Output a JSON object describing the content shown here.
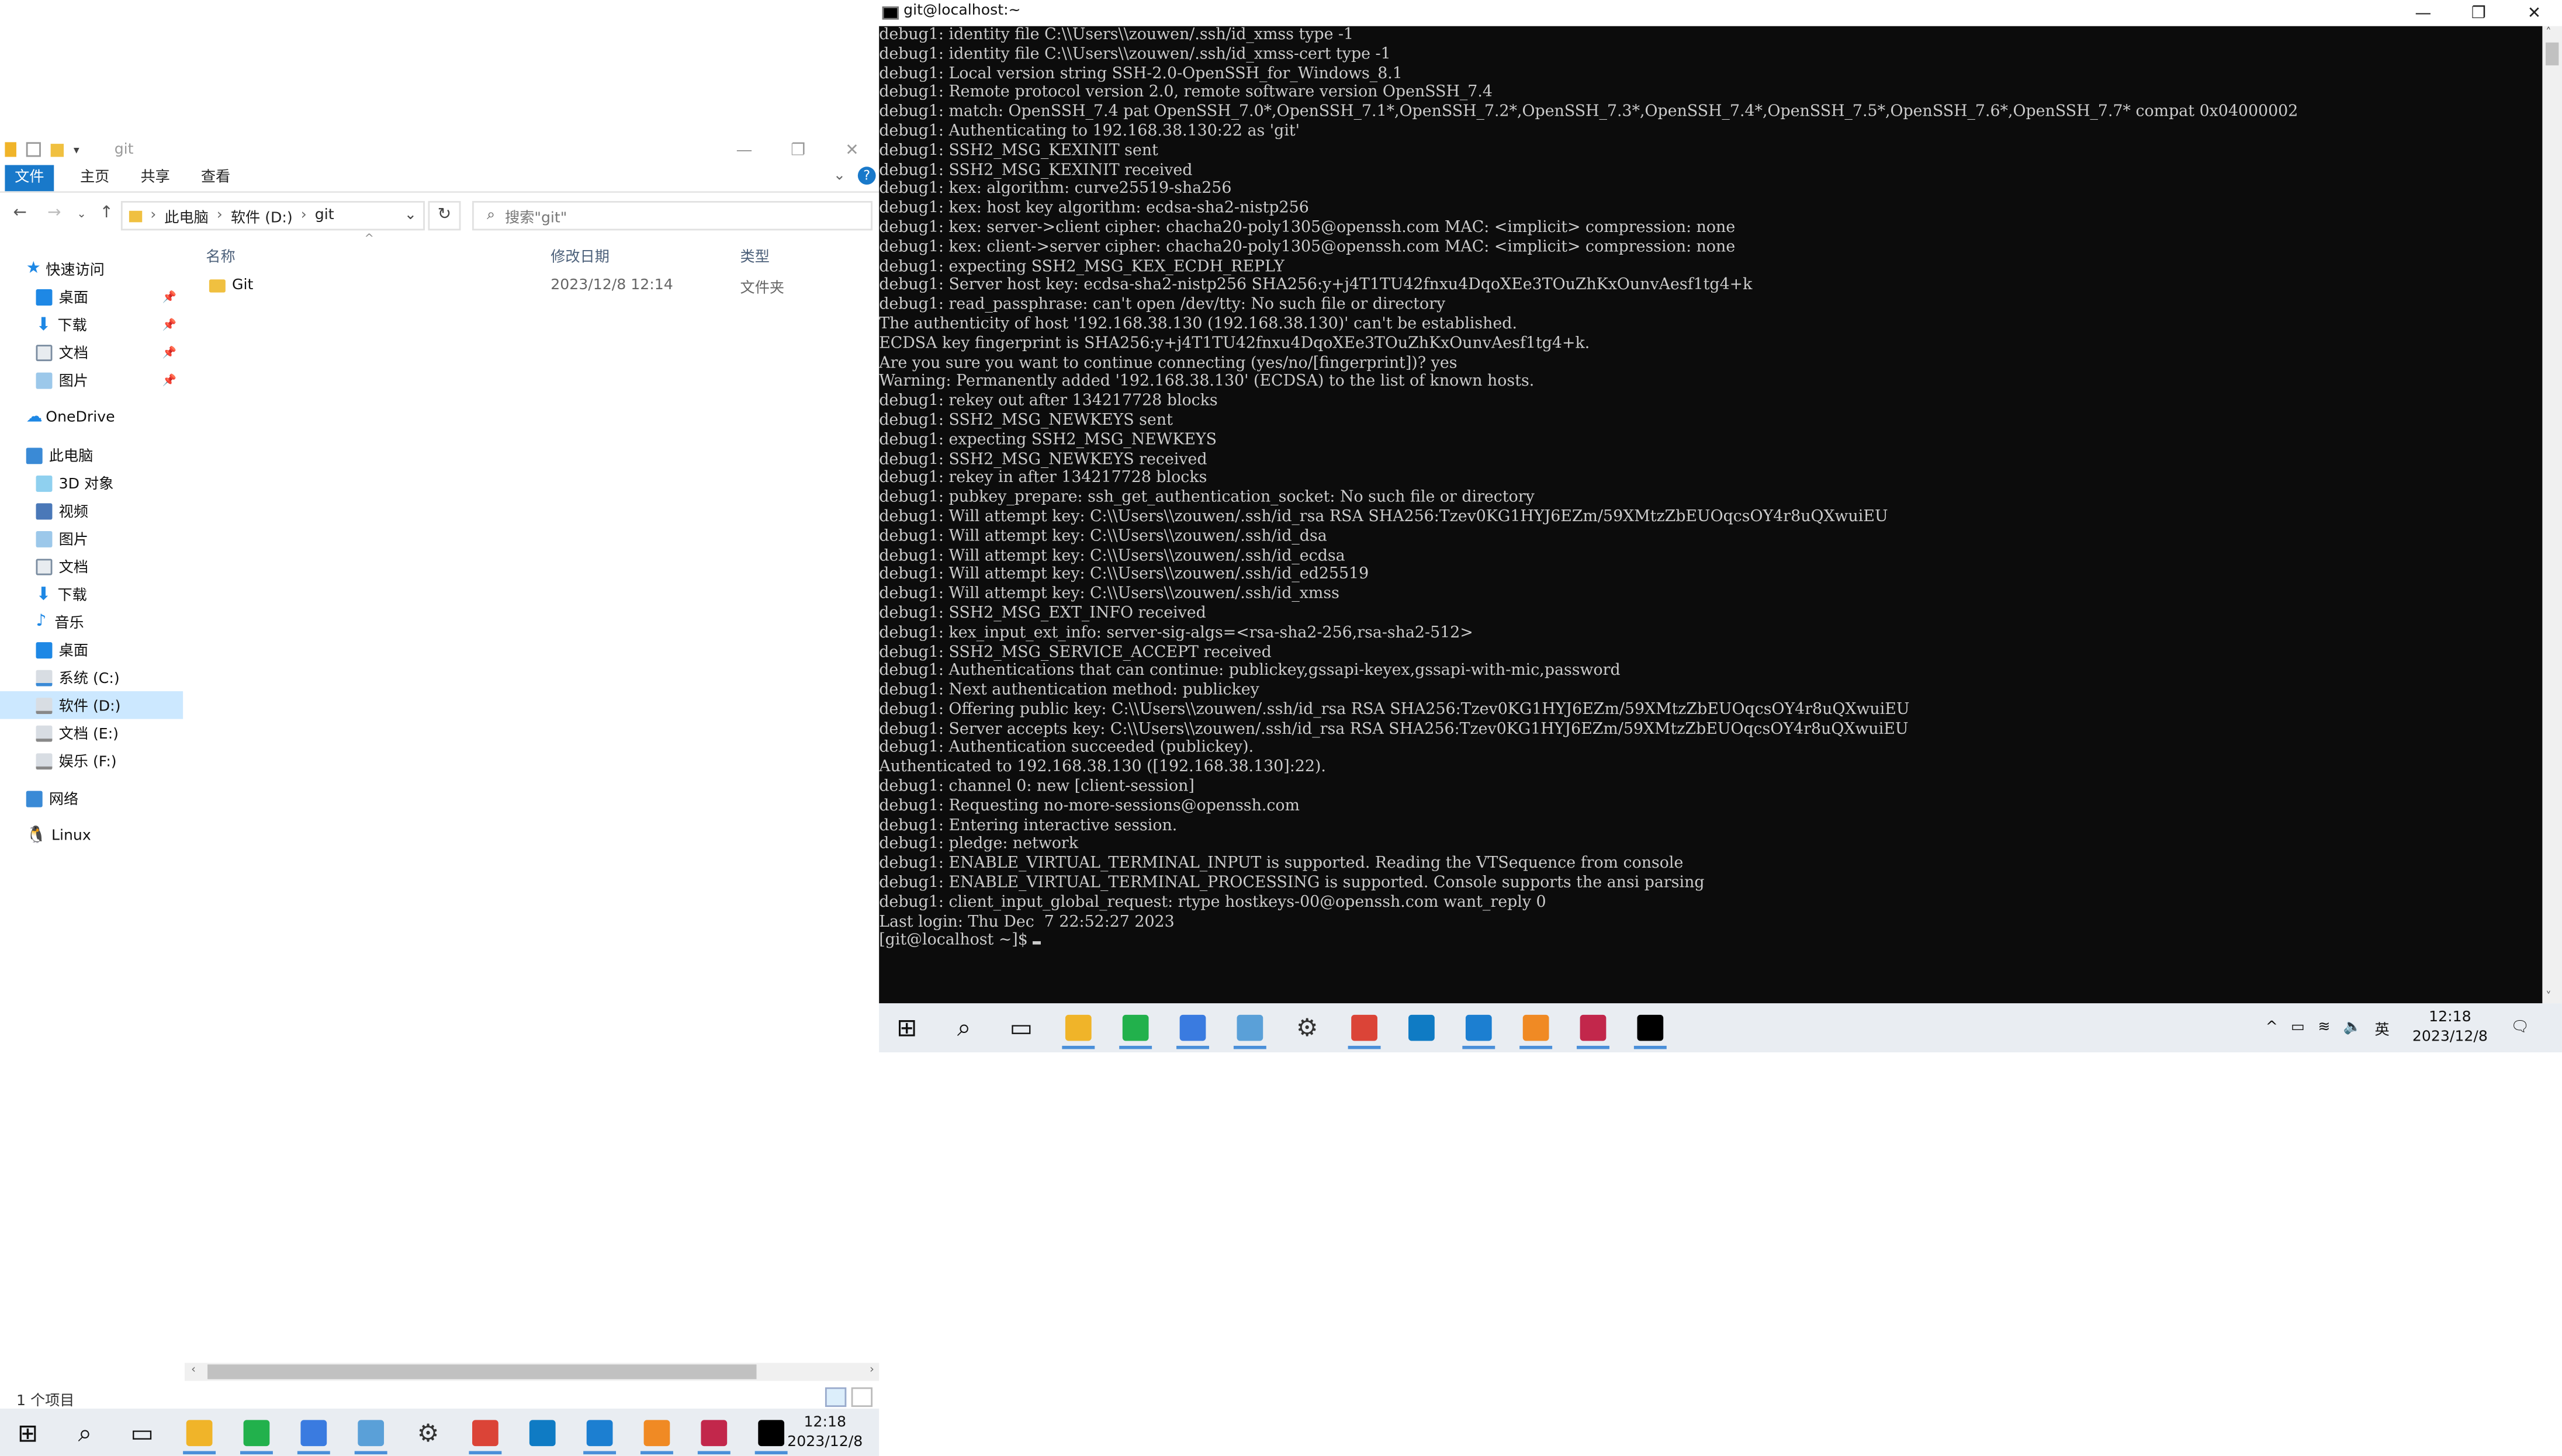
{
  "explorer": {
    "title": "git",
    "tabs": [
      "文件",
      "主页",
      "共享",
      "查看"
    ],
    "address": [
      "此电脑",
      "软件 (D:)",
      "git"
    ],
    "search_placeholder": "搜索\"git\"",
    "sidebar": [
      {
        "label": "快速访问",
        "icon": "star-icon",
        "color": "#1e88e5"
      },
      {
        "label": "桌面",
        "icon": "desktop-icon",
        "color": "#1e88e5",
        "pinned": true
      },
      {
        "label": "下载",
        "icon": "download-icon",
        "color": "#1e88e5",
        "pinned": true
      },
      {
        "label": "文档",
        "icon": "documents-icon",
        "color": "#7a8ca0",
        "pinned": true
      },
      {
        "label": "图片",
        "icon": "pictures-icon",
        "color": "#5aa0d8",
        "pinned": true
      },
      {
        "label": "OneDrive",
        "icon": "onedrive-icon",
        "color": "#1e88e5"
      },
      {
        "label": "此电脑",
        "icon": "computer-icon",
        "color": "#3a8ad6"
      },
      {
        "label": "3D 对象",
        "icon": "3d-objects-icon",
        "color": "#5ab0e0"
      },
      {
        "label": "视频",
        "icon": "video-icon",
        "color": "#4a78b8"
      },
      {
        "label": "图片",
        "icon": "pictures-icon",
        "color": "#5aa0d8"
      },
      {
        "label": "文档",
        "icon": "documents-icon",
        "color": "#7a8ca0"
      },
      {
        "label": "下载",
        "icon": "download-icon",
        "color": "#1e88e5"
      },
      {
        "label": "音乐",
        "icon": "music-icon",
        "color": "#1e88e5"
      },
      {
        "label": "桌面",
        "icon": "desktop-icon",
        "color": "#1e88e5"
      },
      {
        "label": "系统 (C:)",
        "icon": "drive-icon",
        "color": "#888"
      },
      {
        "label": "软件 (D:)",
        "icon": "drive-icon",
        "color": "#888",
        "selected": true
      },
      {
        "label": "文档 (E:)",
        "icon": "drive-icon",
        "color": "#888"
      },
      {
        "label": "娱乐 (F:)",
        "icon": "drive-icon",
        "color": "#888"
      },
      {
        "label": "网络",
        "icon": "network-icon",
        "color": "#3a8ad6"
      },
      {
        "label": "Linux",
        "icon": "linux-icon",
        "color": "#222"
      }
    ],
    "columns": {
      "name": "名称",
      "date": "修改日期",
      "type": "类型"
    },
    "files": [
      {
        "name": "Git",
        "date": "2023/12/8 12:14",
        "type": "文件夹"
      }
    ],
    "status": "1 个项目"
  },
  "taskbar": {
    "time": "12:18",
    "date": "2023/12/8",
    "ime": "英",
    "apps": [
      {
        "icon": "start-icon",
        "color": "#111",
        "glyph": "⊞"
      },
      {
        "icon": "search-icon",
        "color": "#111",
        "glyph": "⌕"
      },
      {
        "icon": "task-view-icon",
        "color": "#111",
        "glyph": "▭"
      },
      {
        "icon": "file-explorer-icon",
        "color": "#f0b429",
        "glyph": "",
        "running": true
      },
      {
        "icon": "wechat-icon",
        "color": "#22b14c",
        "glyph": "",
        "running": true
      },
      {
        "icon": "baidu-netdisk-icon",
        "color": "#3a7be0",
        "glyph": "",
        "running": true
      },
      {
        "icon": "remote-desktop-icon",
        "color": "#5aa0d8",
        "glyph": "",
        "running": true
      },
      {
        "icon": "settings-icon",
        "color": "#333",
        "glyph": "⚙"
      },
      {
        "icon": "chrome-icon",
        "color": "#db4437",
        "glyph": "",
        "running": true
      },
      {
        "icon": "edge-icon",
        "color": "#0f7bc4",
        "glyph": ""
      },
      {
        "icon": "vscode-icon",
        "color": "#1c7fd1",
        "glyph": "",
        "running": true
      },
      {
        "icon": "virtualbox-icon",
        "color": "#f08a24",
        "glyph": "",
        "running": true
      },
      {
        "icon": "snipping-icon",
        "color": "#c2274b",
        "glyph": "",
        "running": true
      },
      {
        "icon": "terminal-icon",
        "color": "#000",
        "glyph": "",
        "running": true
      }
    ]
  },
  "terminal": {
    "title": "git@localhost:~",
    "lines": [
      "debug1: identity file C:\\\\Users\\\\zouwen/.ssh/id_xmss type -1",
      "debug1: identity file C:\\\\Users\\\\zouwen/.ssh/id_xmss-cert type -1",
      "debug1: Local version string SSH-2.0-OpenSSH_for_Windows_8.1",
      "debug1: Remote protocol version 2.0, remote software version OpenSSH_7.4",
      "debug1: match: OpenSSH_7.4 pat OpenSSH_7.0*,OpenSSH_7.1*,OpenSSH_7.2*,OpenSSH_7.3*,OpenSSH_7.4*,OpenSSH_7.5*,OpenSSH_7.6*,OpenSSH_7.7* compat 0x04000002",
      "debug1: Authenticating to 192.168.38.130:22 as 'git'",
      "debug1: SSH2_MSG_KEXINIT sent",
      "debug1: SSH2_MSG_KEXINIT received",
      "debug1: kex: algorithm: curve25519-sha256",
      "debug1: kex: host key algorithm: ecdsa-sha2-nistp256",
      "debug1: kex: server->client cipher: chacha20-poly1305@openssh.com MAC: <implicit> compression: none",
      "debug1: kex: client->server cipher: chacha20-poly1305@openssh.com MAC: <implicit> compression: none",
      "debug1: expecting SSH2_MSG_KEX_ECDH_REPLY",
      "debug1: Server host key: ecdsa-sha2-nistp256 SHA256:y+j4T1TU42fnxu4DqoXEe3TOuZhKxOunvAesf1tg4+k",
      "debug1: read_passphrase: can't open /dev/tty: No such file or directory",
      "The authenticity of host '192.168.38.130 (192.168.38.130)' can't be established.",
      "ECDSA key fingerprint is SHA256:y+j4T1TU42fnxu4DqoXEe3TOuZhKxOunvAesf1tg4+k.",
      "Are you sure you want to continue connecting (yes/no/[fingerprint])? yes",
      "Warning: Permanently added '192.168.38.130' (ECDSA) to the list of known hosts.",
      "debug1: rekey out after 134217728 blocks",
      "debug1: SSH2_MSG_NEWKEYS sent",
      "debug1: expecting SSH2_MSG_NEWKEYS",
      "debug1: SSH2_MSG_NEWKEYS received",
      "debug1: rekey in after 134217728 blocks",
      "debug1: pubkey_prepare: ssh_get_authentication_socket: No such file or directory",
      "debug1: Will attempt key: C:\\\\Users\\\\zouwen/.ssh/id_rsa RSA SHA256:Tzev0KG1HYJ6EZm/59XMtzZbEUOqcsOY4r8uQXwuiEU",
      "debug1: Will attempt key: C:\\\\Users\\\\zouwen/.ssh/id_dsa",
      "debug1: Will attempt key: C:\\\\Users\\\\zouwen/.ssh/id_ecdsa",
      "debug1: Will attempt key: C:\\\\Users\\\\zouwen/.ssh/id_ed25519",
      "debug1: Will attempt key: C:\\\\Users\\\\zouwen/.ssh/id_xmss",
      "debug1: SSH2_MSG_EXT_INFO received",
      "debug1: kex_input_ext_info: server-sig-algs=<rsa-sha2-256,rsa-sha2-512>",
      "debug1: SSH2_MSG_SERVICE_ACCEPT received",
      "debug1: Authentications that can continue: publickey,gssapi-keyex,gssapi-with-mic,password",
      "debug1: Next authentication method: publickey",
      "debug1: Offering public key: C:\\\\Users\\\\zouwen/.ssh/id_rsa RSA SHA256:Tzev0KG1HYJ6EZm/59XMtzZbEUOqcsOY4r8uQXwuiEU",
      "debug1: Server accepts key: C:\\\\Users\\\\zouwen/.ssh/id_rsa RSA SHA256:Tzev0KG1HYJ6EZm/59XMtzZbEUOqcsOY4r8uQXwuiEU",
      "debug1: Authentication succeeded (publickey).",
      "Authenticated to 192.168.38.130 ([192.168.38.130]:22).",
      "debug1: channel 0: new [client-session]",
      "debug1: Requesting no-more-sessions@openssh.com",
      "debug1: Entering interactive session.",
      "debug1: pledge: network",
      "debug1: ENABLE_VIRTUAL_TERMINAL_INPUT is supported. Reading the VTSequence from console",
      "debug1: ENABLE_VIRTUAL_TERMINAL_PROCESSING is supported. Console supports the ansi parsing",
      "debug1: client_input_global_request: rtype hostkeys-00@openssh.com want_reply 0",
      "Last login: Thu Dec  7 22:52:27 2023"
    ],
    "prompt": "[git@localhost ~]$ "
  }
}
